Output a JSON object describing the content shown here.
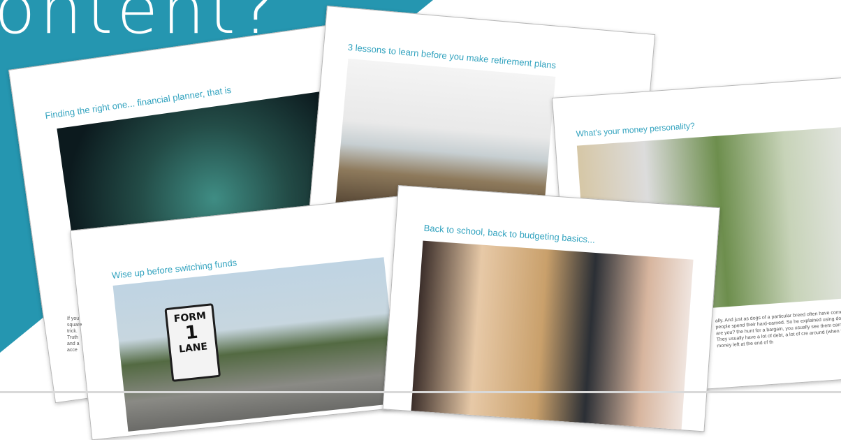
{
  "headline": "ontent?",
  "cards": [
    {
      "title": "Finding the right one... financial planner, that is",
      "text": "If you square trick. Truth and a acce"
    },
    {
      "title": "3 lessons to learn before you make retirement plans"
    },
    {
      "title": "What's your money personality?",
      "text": "ally. And just as dogs of a particular breed often have comes to how people spend their hard-earned. So he explained using dogs. Which one are you? the hunt for a bargain, you usually see them carrying ally need. They usually have a lot of debt, a lot of cre around (when they've got money left at the end of th"
    },
    {
      "title": "Wise up before switching funds",
      "sign": {
        "line1": "FORM",
        "line2": "1",
        "line3": "LANE"
      }
    },
    {
      "title": "Back to school, back to budgeting basics..."
    }
  ],
  "colors": {
    "teal": "#2596b0",
    "title_teal": "#33a3bf"
  }
}
